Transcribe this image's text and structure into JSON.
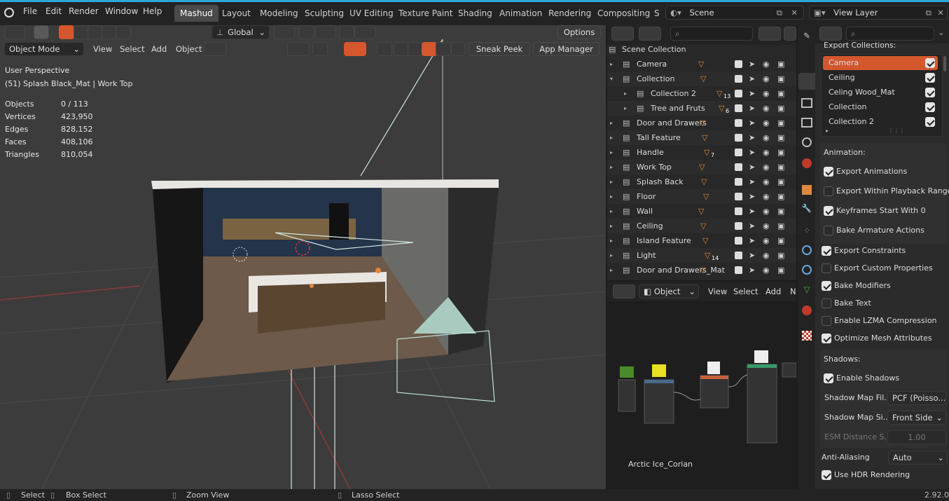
{
  "top_menu": [
    "File",
    "Edit",
    "Render",
    "Window",
    "Help"
  ],
  "workspaces": [
    "Mashud",
    "Layout",
    "Modeling",
    "Sculpting",
    "UV Editing",
    "Texture Paint",
    "Shading",
    "Animation",
    "Rendering",
    "Compositing",
    "S"
  ],
  "active_workspace": "Mashud",
  "scene": "Scene",
  "view_layer": "View Layer",
  "viewport_header": {
    "transform_orientation": "Global",
    "options": "Options",
    "mode": "Object Mode",
    "menus": [
      "View",
      "Select",
      "Add",
      "Object"
    ],
    "sneak_peek": "Sneak Peek",
    "app_manager": "App Manager"
  },
  "viewport_info": {
    "perspective": "User Perspective",
    "object": "(51) Splash Black_Mat | Work Top",
    "stats": [
      {
        "label": "Objects",
        "value": "0 / 113"
      },
      {
        "label": "Vertices",
        "value": "423,950"
      },
      {
        "label": "Edges",
        "value": "828,152"
      },
      {
        "label": "Faces",
        "value": "408,106"
      },
      {
        "label": "Triangles",
        "value": "810,054"
      }
    ]
  },
  "outliner": {
    "root": "Scene Collection",
    "rows": [
      {
        "name": "Camera",
        "indent": 0,
        "badge": ""
      },
      {
        "name": "Collection",
        "indent": 0,
        "badge": ""
      },
      {
        "name": "Collection 2",
        "indent": 1,
        "badge": "13"
      },
      {
        "name": "Tree and Fruts",
        "indent": 1,
        "badge": "6"
      },
      {
        "name": "Door and Drawers",
        "indent": 0,
        "badge": ""
      },
      {
        "name": "Tall Feature",
        "indent": 0,
        "badge": ""
      },
      {
        "name": "Handle",
        "indent": 0,
        "badge": "7"
      },
      {
        "name": "Work Top",
        "indent": 0,
        "badge": ""
      },
      {
        "name": "Splash Back",
        "indent": 0,
        "badge": ""
      },
      {
        "name": "Floor",
        "indent": 0,
        "badge": ""
      },
      {
        "name": "Wall",
        "indent": 0,
        "badge": ""
      },
      {
        "name": "Ceiling",
        "indent": 0,
        "badge": ""
      },
      {
        "name": "Island Feature",
        "indent": 0,
        "badge": ""
      },
      {
        "name": "Light",
        "indent": 0,
        "badge": "14"
      },
      {
        "name": "Door and Drawers_Mat",
        "indent": 0,
        "badge": ""
      }
    ]
  },
  "node_editor": {
    "type": "Object",
    "menus": [
      "View",
      "Select",
      "Add",
      "N"
    ],
    "material_label": "Arctic Ice_Corian"
  },
  "properties": {
    "export_collections_label": "Export Collections:",
    "collections": [
      {
        "name": "Camera",
        "checked": true,
        "active": true
      },
      {
        "name": "Ceiling",
        "checked": true,
        "active": false
      },
      {
        "name": "Celing Wood_Mat",
        "checked": true,
        "active": false
      },
      {
        "name": "Collection",
        "checked": true,
        "active": false
      },
      {
        "name": "Collection 2",
        "checked": true,
        "active": false
      }
    ],
    "animation_label": "Animation:",
    "animation_options": [
      {
        "label": "Export Animations",
        "checked": true
      },
      {
        "label": "Export Within Playback Range",
        "checked": false
      },
      {
        "label": "Keyframes Start With 0",
        "checked": true
      },
      {
        "label": "Bake Armature Actions",
        "checked": false
      }
    ],
    "general_options": [
      {
        "label": "Export Constraints",
        "checked": true
      },
      {
        "label": "Export Custom Properties",
        "checked": false
      },
      {
        "label": "Bake Modifiers",
        "checked": true
      },
      {
        "label": "Bake Text",
        "checked": false
      },
      {
        "label": "Enable LZMA Compression",
        "checked": false
      },
      {
        "label": "Optimize Mesh Attributes",
        "checked": true
      }
    ],
    "shadows_label": "Shadows:",
    "enable_shadows": {
      "label": "Enable Shadows",
      "checked": true
    },
    "shadow_map_filter": {
      "label": "Shadow Map Fil...",
      "value": "PCF (Poisso..."
    },
    "shadow_map_side": {
      "label": "Shadow Map Si...",
      "value": "Front Side"
    },
    "esm_distance": {
      "label": "ESM Distance S...",
      "value": "1.00"
    },
    "anti_aliasing": {
      "label": "Anti-Aliasing",
      "value": "Auto"
    },
    "use_hdr": {
      "label": "Use HDR Rendering",
      "checked": true
    }
  },
  "statusbar": {
    "items": [
      "Select",
      "Box Select",
      "Zoom View",
      "Lasso Select"
    ],
    "version": "2.92.0"
  },
  "colors": {
    "accent": "#2aa9d8",
    "active_orange": "#d4572d",
    "icon_orange": "#e0883a"
  }
}
